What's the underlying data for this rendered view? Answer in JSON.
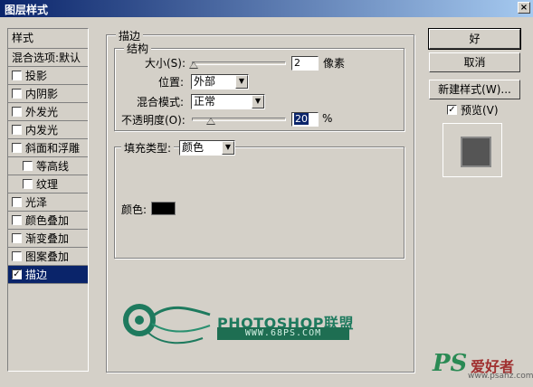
{
  "window": {
    "title": "图层样式",
    "close_glyph": "×"
  },
  "styles": {
    "header": "样式",
    "blend_options": "混合选项:默认",
    "items": [
      {
        "label": "投影",
        "checked": false,
        "indent": false
      },
      {
        "label": "内阴影",
        "checked": false,
        "indent": false
      },
      {
        "label": "外发光",
        "checked": false,
        "indent": false
      },
      {
        "label": "内发光",
        "checked": false,
        "indent": false
      },
      {
        "label": "斜面和浮雕",
        "checked": false,
        "indent": false
      },
      {
        "label": "等高线",
        "checked": false,
        "indent": true
      },
      {
        "label": "纹理",
        "checked": false,
        "indent": true
      },
      {
        "label": "光泽",
        "checked": false,
        "indent": false
      },
      {
        "label": "颜色叠加",
        "checked": false,
        "indent": false
      },
      {
        "label": "渐变叠加",
        "checked": false,
        "indent": false
      },
      {
        "label": "图案叠加",
        "checked": false,
        "indent": false
      },
      {
        "label": "描边",
        "checked": true,
        "indent": false,
        "selected": true
      }
    ],
    "check_glyph": "✓"
  },
  "stroke": {
    "group_title": "描边",
    "structure_title": "结构",
    "size_label": "大小(S):",
    "size_value": "2",
    "size_unit": "像素",
    "size_slider_fraction": 0.02,
    "position_label": "位置:",
    "position_value": "外部",
    "blend_label": "混合模式:",
    "blend_value": "正常",
    "opacity_label": "不透明度(O):",
    "opacity_value": "20",
    "opacity_unit": "%",
    "opacity_slider_fraction": 0.2,
    "fill_type_label": "填充类型:",
    "fill_type_value": "颜色",
    "color_label": "颜色:",
    "color_value": "#000000"
  },
  "buttons": {
    "ok": "好",
    "cancel": "取消",
    "new_style": "新建样式(W)...",
    "preview_label": "预览(V)",
    "preview_checked": true
  },
  "branding": {
    "logo_text": "PHOTOSHOP联盟",
    "logo_url": "WWW.68PS.COM",
    "watermark_ps": "PS",
    "watermark_cn": "爱好者",
    "watermark_url": "www.psahz.com"
  },
  "colors": {
    "titlebar": "#0a246a",
    "selection": "#0a246a",
    "logo_green": "#1e7a5e"
  }
}
